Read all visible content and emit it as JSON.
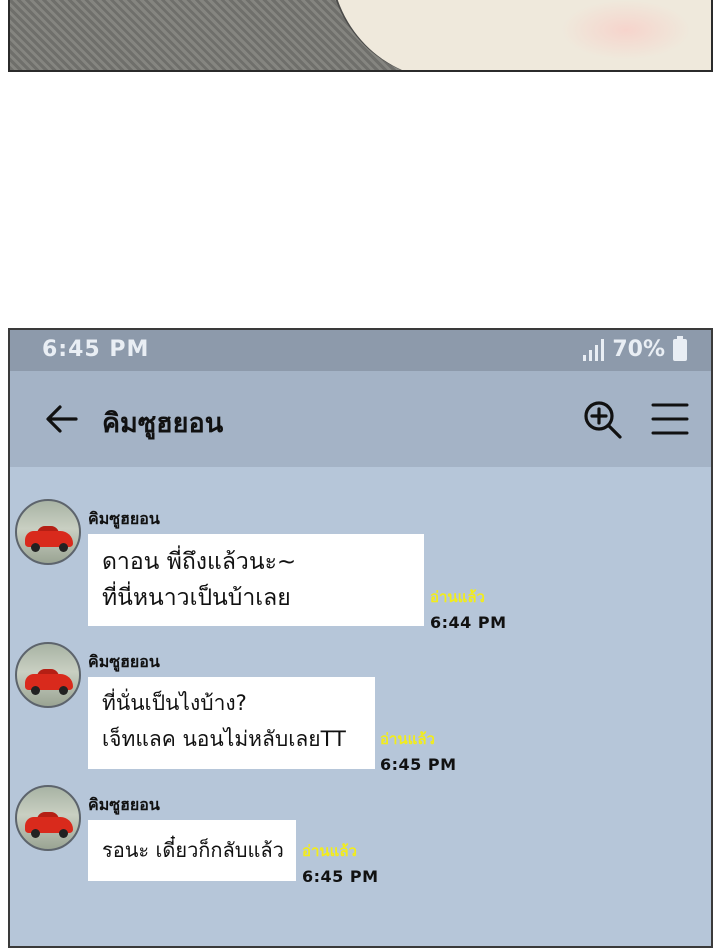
{
  "status_bar": {
    "time": "6:45 PM",
    "battery": "70%"
  },
  "header": {
    "title": "คิมซูฮยอน",
    "back_icon": "arrow-left-icon",
    "search_icon": "zoom-in-icon",
    "menu_icon": "hamburger-menu-icon"
  },
  "messages": [
    {
      "sender": "คิมซูฮยอน",
      "lines": [
        "ดาอน พี่ถึงแล้วนะ~",
        "ที่นี่หนาวเป็นบ้าเลย"
      ],
      "read": "อ่านแล้ว",
      "time": "6:44 PM"
    },
    {
      "sender": "คิมซูฮยอน",
      "lines": [
        "ที่นั่นเป็นไงบ้าง?",
        "เจ็ทแลค นอนไม่หลับเลยTT"
      ],
      "read": "อ่านแล้ว",
      "time": "6:45 PM"
    },
    {
      "sender": "คิมซูฮยอน",
      "lines": [
        "รอนะ เดี๋ยวก็กลับแล้ว"
      ],
      "read": "อ่านแล้ว",
      "time": "6:45 PM"
    }
  ],
  "colors": {
    "chat_background": "#b6c6d9",
    "header_background": "#a4b3c6",
    "status_bar_background": "#8d9aab",
    "read_receipt": "#f2ec1c"
  }
}
